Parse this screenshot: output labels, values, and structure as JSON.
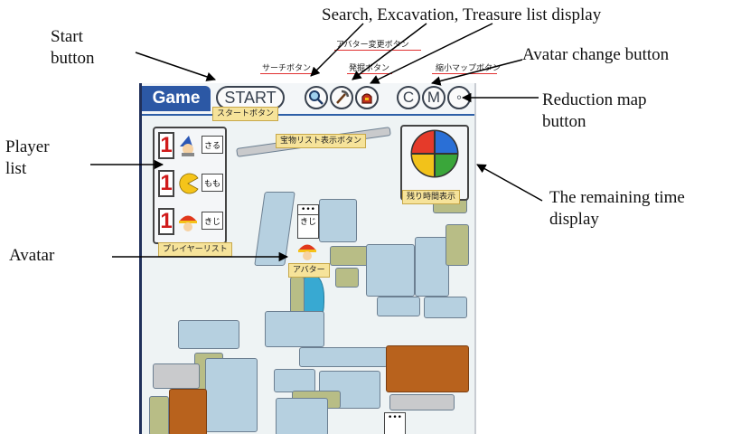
{
  "annotations": {
    "search_excavation": "Search, Excavation, Treasure list display",
    "start_button_1": "Start",
    "start_button_2": "button",
    "avatar_change": "Avatar change button",
    "reduction_map_1": "Reduction map",
    "reduction_map_2": "button",
    "player_list_1": "Player",
    "player_list_2": "list",
    "remaining_time_1": "The remaining time",
    "remaining_time_2": "display",
    "avatar": "Avatar"
  },
  "jp_labels": {
    "avatar_change_jp": "アバター変更ボタン",
    "search_jp": "サーチボタン",
    "excavation_jp": "発掘ボタン",
    "minimap_jp": "縮小マップボタン",
    "start_jp": "スタートボタン",
    "treasure_jp": "宝物リスト表示ボタン",
    "timer_jp": "残り時間表示",
    "player_list_jp": "プレイヤーリスト",
    "avatar_jp": "アバター"
  },
  "screen": {
    "game_tab": "Game",
    "start": "START",
    "btn_c": "C",
    "btn_m": "M",
    "btn_extra": "◦"
  },
  "players": [
    {
      "rank": "1",
      "name": "さる",
      "avatar": "wizard-icon"
    },
    {
      "rank": "1",
      "name": "もも",
      "avatar": "pacman-icon"
    },
    {
      "rank": "1",
      "name": "きじ",
      "avatar": "helmet-icon"
    }
  ],
  "map_bubble": {
    "dots": "•••",
    "name": "きじ"
  },
  "map_bubble2": {
    "dots": "•••"
  },
  "colors": {
    "accent": "#2c58a5",
    "rank_red": "#d01b1b",
    "pie_red": "#e53a2a",
    "pie_blue": "#2a6fd6",
    "pie_yellow": "#f2c21a",
    "pie_green": "#3aa63a"
  }
}
